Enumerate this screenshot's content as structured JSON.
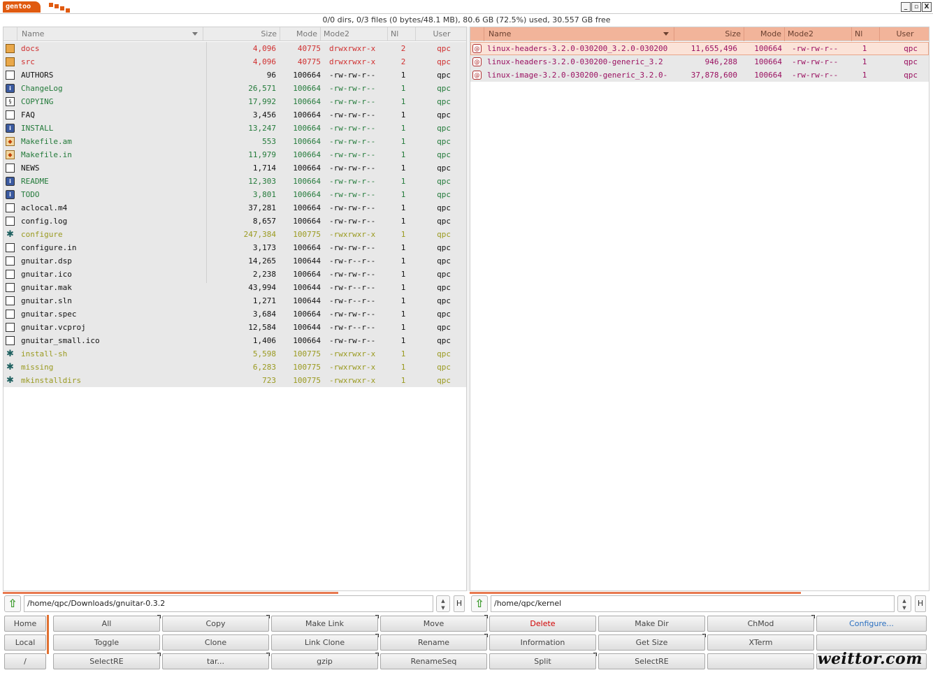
{
  "window": {
    "title": "gentoo",
    "status": "0/0 dirs, 0/3 files (0 bytes/48.1 MB), 80.6 GB (72.5%) used, 30.557 GB free",
    "controls": [
      "_",
      "▫",
      "X"
    ]
  },
  "columns": {
    "name": "Name",
    "size": "Size",
    "mode": "Mode",
    "mode2": "Mode2",
    "nl": "Nl",
    "user": "User"
  },
  "left_panel": {
    "path": "/home/qpc/Downloads/gnuitar-0.3.2",
    "files": [
      {
        "name": "docs",
        "size": "4,096",
        "mode": "40775",
        "mode2": "drwxrwxr-x",
        "nl": "2",
        "user": "qpc",
        "color": "red",
        "icon": "folder-icon"
      },
      {
        "name": "src",
        "size": "4,096",
        "mode": "40775",
        "mode2": "drwxrwxr-x",
        "nl": "2",
        "user": "qpc",
        "color": "red",
        "icon": "folder-icon"
      },
      {
        "name": "AUTHORS",
        "size": "96",
        "mode": "100664",
        "mode2": "-rw-rw-r--",
        "nl": "1",
        "user": "qpc",
        "color": "black",
        "icon": "file-icon"
      },
      {
        "name": "ChangeLog",
        "size": "26,571",
        "mode": "100664",
        "mode2": "-rw-rw-r--",
        "nl": "1",
        "user": "qpc",
        "color": "green",
        "icon": "info-icon"
      },
      {
        "name": "COPYING",
        "size": "17,992",
        "mode": "100664",
        "mode2": "-rw-rw-r--",
        "nl": "1",
        "user": "qpc",
        "color": "green",
        "icon": "legal-icon"
      },
      {
        "name": "FAQ",
        "size": "3,456",
        "mode": "100664",
        "mode2": "-rw-rw-r--",
        "nl": "1",
        "user": "qpc",
        "color": "black",
        "icon": "file-icon"
      },
      {
        "name": "INSTALL",
        "size": "13,247",
        "mode": "100664",
        "mode2": "-rw-rw-r--",
        "nl": "1",
        "user": "qpc",
        "color": "green",
        "icon": "info-icon"
      },
      {
        "name": "Makefile.am",
        "size": "553",
        "mode": "100664",
        "mode2": "-rw-rw-r--",
        "nl": "1",
        "user": "qpc",
        "color": "green",
        "icon": "makefile-icon"
      },
      {
        "name": "Makefile.in",
        "size": "11,979",
        "mode": "100664",
        "mode2": "-rw-rw-r--",
        "nl": "1",
        "user": "qpc",
        "color": "green",
        "icon": "makefile-icon"
      },
      {
        "name": "NEWS",
        "size": "1,714",
        "mode": "100664",
        "mode2": "-rw-rw-r--",
        "nl": "1",
        "user": "qpc",
        "color": "black",
        "icon": "file-icon"
      },
      {
        "name": "README",
        "size": "12,303",
        "mode": "100664",
        "mode2": "-rw-rw-r--",
        "nl": "1",
        "user": "qpc",
        "color": "green",
        "icon": "info-icon"
      },
      {
        "name": "TODO",
        "size": "3,801",
        "mode": "100664",
        "mode2": "-rw-rw-r--",
        "nl": "1",
        "user": "qpc",
        "color": "green",
        "icon": "info-icon"
      },
      {
        "name": "aclocal.m4",
        "size": "37,281",
        "mode": "100664",
        "mode2": "-rw-rw-r--",
        "nl": "1",
        "user": "qpc",
        "color": "black",
        "icon": "file-icon"
      },
      {
        "name": "config.log",
        "size": "8,657",
        "mode": "100664",
        "mode2": "-rw-rw-r--",
        "nl": "1",
        "user": "qpc",
        "color": "black",
        "icon": "file-icon"
      },
      {
        "name": "configure",
        "size": "247,384",
        "mode": "100775",
        "mode2": "-rwxrwxr-x",
        "nl": "1",
        "user": "qpc",
        "color": "olive",
        "icon": "executable-icon"
      },
      {
        "name": "configure.in",
        "size": "3,173",
        "mode": "100664",
        "mode2": "-rw-rw-r--",
        "nl": "1",
        "user": "qpc",
        "color": "black",
        "icon": "file-icon"
      },
      {
        "name": "gnuitar.dsp",
        "size": "14,265",
        "mode": "100644",
        "mode2": "-rw-r--r--",
        "nl": "1",
        "user": "qpc",
        "color": "black",
        "icon": "file-icon"
      },
      {
        "name": "gnuitar.ico",
        "size": "2,238",
        "mode": "100664",
        "mode2": "-rw-rw-r--",
        "nl": "1",
        "user": "qpc",
        "color": "black",
        "icon": "file-icon"
      },
      {
        "name": "gnuitar.mak",
        "size": "43,994",
        "mode": "100644",
        "mode2": "-rw-r--r--",
        "nl": "1",
        "user": "qpc",
        "color": "black",
        "icon": "file-icon"
      },
      {
        "name": "gnuitar.sln",
        "size": "1,271",
        "mode": "100644",
        "mode2": "-rw-r--r--",
        "nl": "1",
        "user": "qpc",
        "color": "black",
        "icon": "file-icon"
      },
      {
        "name": "gnuitar.spec",
        "size": "3,684",
        "mode": "100664",
        "mode2": "-rw-rw-r--",
        "nl": "1",
        "user": "qpc",
        "color": "black",
        "icon": "file-icon"
      },
      {
        "name": "gnuitar.vcproj",
        "size": "12,584",
        "mode": "100644",
        "mode2": "-rw-r--r--",
        "nl": "1",
        "user": "qpc",
        "color": "black",
        "icon": "file-icon"
      },
      {
        "name": "gnuitar_small.ico",
        "size": "1,406",
        "mode": "100664",
        "mode2": "-rw-rw-r--",
        "nl": "1",
        "user": "qpc",
        "color": "black",
        "icon": "file-icon"
      },
      {
        "name": "install-sh",
        "size": "5,598",
        "mode": "100775",
        "mode2": "-rwxrwxr-x",
        "nl": "1",
        "user": "qpc",
        "color": "olive",
        "icon": "executable-icon"
      },
      {
        "name": "missing",
        "size": "6,283",
        "mode": "100775",
        "mode2": "-rwxrwxr-x",
        "nl": "1",
        "user": "qpc",
        "color": "olive",
        "icon": "executable-icon"
      },
      {
        "name": "mkinstalldirs",
        "size": "723",
        "mode": "100775",
        "mode2": "-rwxrwxr-x",
        "nl": "1",
        "user": "qpc",
        "color": "olive",
        "icon": "executable-icon"
      }
    ]
  },
  "right_panel": {
    "path": "/home/qpc/kernel",
    "files": [
      {
        "name": "linux-headers-3.2.0-030200_3.2.0-030200",
        "size": "11,655,496",
        "mode": "100664",
        "mode2": "-rw-rw-r--",
        "nl": "1",
        "user": "qpc",
        "color": "magenta",
        "icon": "debian-package-icon",
        "selected": true
      },
      {
        "name": "linux-headers-3.2.0-030200-generic_3.2",
        "size": "946,288",
        "mode": "100664",
        "mode2": "-rw-rw-r--",
        "nl": "1",
        "user": "qpc",
        "color": "magenta",
        "icon": "debian-package-icon"
      },
      {
        "name": "linux-image-3.2.0-030200-generic_3.2.0-",
        "size": "37,878,600",
        "mode": "100664",
        "mode2": "-rw-rw-r--",
        "nl": "1",
        "user": "qpc",
        "color": "magenta",
        "icon": "debian-package-icon"
      }
    ]
  },
  "path_controls": {
    "up": "⇧",
    "history": "H"
  },
  "sidebar_buttons": [
    "Home",
    "Local",
    "/"
  ],
  "buttons": [
    [
      "All",
      "Copy",
      "Make Link",
      "Move",
      "Delete",
      "Make Dir",
      "ChMod",
      "Configure..."
    ],
    [
      "Toggle",
      "Clone",
      "Link Clone",
      "Rename",
      "Information",
      "Get Size",
      "XTerm",
      ""
    ],
    [
      "SelectRE",
      "tar...",
      "gzip",
      "RenameSeq",
      "Split",
      "SelectRE",
      "",
      ""
    ]
  ],
  "watermark": "weittor.com",
  "colors": {
    "accent": "#e05a10",
    "right_header": "#f2b49a",
    "dir": "#d03030",
    "doc": "#237a3a",
    "exec": "#9a9a20",
    "deb": "#9a1060",
    "delete_label": "#d00000",
    "configure_label": "#2a6fc0"
  }
}
